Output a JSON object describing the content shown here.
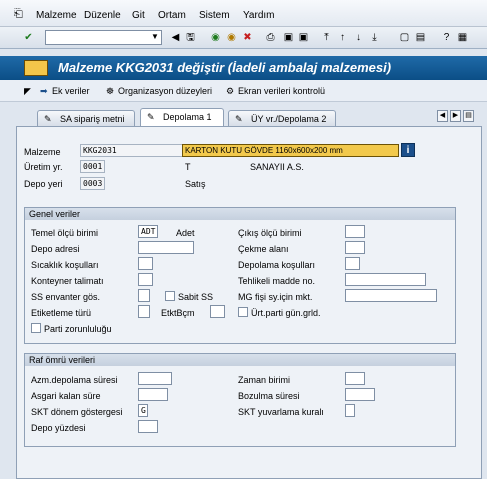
{
  "menu": {
    "items": [
      "Malzeme",
      "Düzenle",
      "Git",
      "Ortam",
      "Sistem",
      "Yardım"
    ]
  },
  "toolbar": {
    "command_value": ""
  },
  "title": "Malzeme KKG2031 değiştir (İadeli ambalaj malzemesi)",
  "app_toolbar": {
    "ek_veriler": "Ek veriler",
    "org_duzeyleri": "Organizasyon düzeyleri",
    "ekran_verileri": "Ekran verileri kontrolü"
  },
  "tabs": [
    {
      "label": "SA sipariş metni"
    },
    {
      "label": "Depolama 1"
    },
    {
      "label": "ÜY vr./Depolama 2"
    }
  ],
  "header": {
    "malzeme_label": "Malzeme",
    "malzeme_value": "KKG2031",
    "malzeme_desc": "KARTON KUTU GÖVDE 1160x600x200 mm",
    "uretim_label": "Üretim yr.",
    "uretim_value": "0001",
    "uretim_code": "T",
    "uretim_name": "SANAYII A.S.",
    "depo_label": "Depo yeri",
    "depo_value": "0003",
    "depo_name": "Satış"
  },
  "genel": {
    "title": "Genel veriler",
    "temel_label": "Temel ölçü birimi",
    "temel_value": "ADT",
    "temel_text": "Adet",
    "cikis_label": "Çıkış ölçü birimi",
    "depo_adresi_label": "Depo adresi",
    "cekme_label": "Çekme alanı",
    "sicaklik_label": "Sıcaklık koşulları",
    "depolama_kos_label": "Depolama koşulları",
    "konteyner_label": "Konteyner talimatı",
    "tehlikeli_label": "Tehlikeli madde no.",
    "ss_envanter_label": "SS envanter gös.",
    "sabit_ss_label": "Sabit SS",
    "mg_fisi_label": "MG fişi sy.için mkt.",
    "etiketleme_label": "Etiketleme türü",
    "etktbcm_label": "EtktBçm",
    "urt_parti_label": "Ürt.parti gün.grld.",
    "parti_zor_label": "Parti zorunluluğu"
  },
  "raf": {
    "title": "Raf ömrü verileri",
    "azm_label": "Azm.depolama süresi",
    "zaman_label": "Zaman birimi",
    "asgari_label": "Asgari kalan süre",
    "bozulma_label": "Bozulma süresi",
    "skt_donem_label": "SKT dönem göstergesi",
    "skt_donem_value": "G",
    "skt_yuvarlama_label": "SKT yuvarlama kuralı",
    "depo_yuzdesi_label": "Depo yüzdesi"
  },
  "colors": {
    "title_bar": "#0b4e86",
    "highlight_field": "#f2c94c"
  }
}
